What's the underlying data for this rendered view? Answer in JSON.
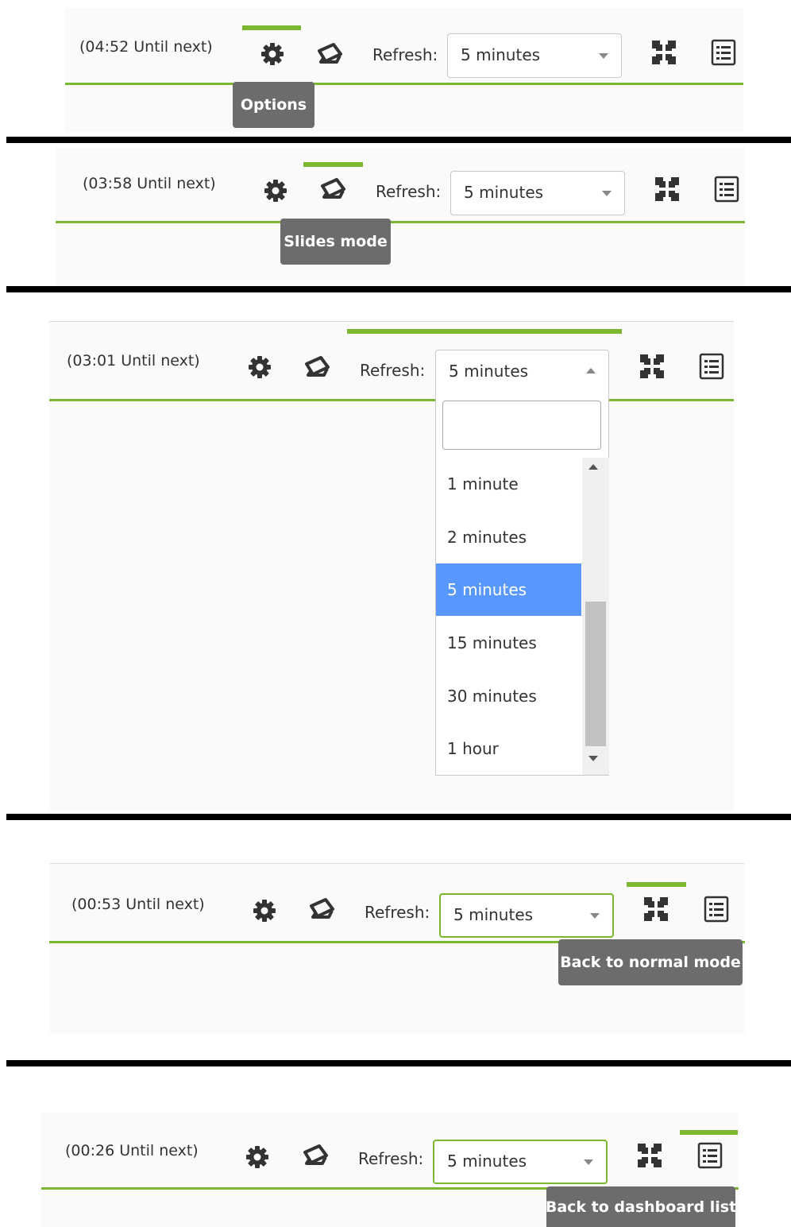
{
  "accent_color": "#7cb82f",
  "tooltip_color": "#6c6c6c",
  "selected_option_color": "#5897fb",
  "refresh_label": "Refresh:",
  "panels": [
    {
      "countdown": "(04:52 Until next)",
      "selected": "5 minutes",
      "tooltip": "Options",
      "highlight": "options-icon"
    },
    {
      "countdown": "(03:58 Until next)",
      "selected": "5 minutes",
      "tooltip": "Slides mode",
      "highlight": "slides-mode-icon"
    },
    {
      "countdown": "(03:01 Until next)",
      "selected": "5 minutes",
      "tooltip": "",
      "highlight": "refresh-select"
    },
    {
      "countdown": "(00:53 Until next)",
      "selected": "5 minutes",
      "tooltip": "Back to normal mode",
      "highlight": "normal-mode-icon"
    },
    {
      "countdown": "(00:26 Until next)",
      "selected": "5 minutes",
      "tooltip": "Back to dashboard list",
      "highlight": "dashboard-list-icon"
    }
  ],
  "refresh_options": [
    "1 minute",
    "2 minutes",
    "5 minutes",
    "15 minutes",
    "30 minutes",
    "1 hour"
  ],
  "refresh_selected_index": 2,
  "search_value": "",
  "icons": [
    "gear-icon",
    "slides-icon",
    "compress-icon",
    "list-icon"
  ]
}
